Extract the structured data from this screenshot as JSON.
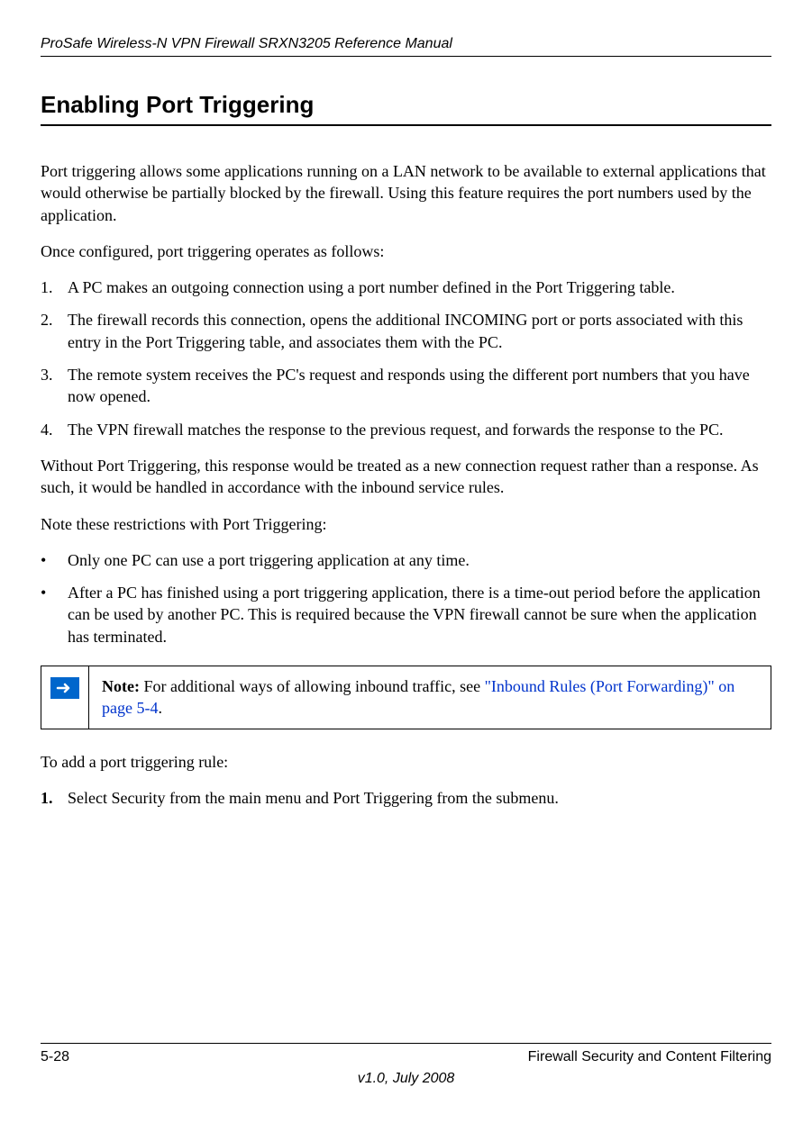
{
  "header": {
    "title": "ProSafe Wireless-N VPN Firewall SRXN3205 Reference Manual"
  },
  "section": {
    "heading": "Enabling Port Triggering"
  },
  "paragraphs": {
    "p1": "Port triggering allows some applications running on a LAN network to be available to external applications that would otherwise be partially blocked by the firewall. Using this feature requires the port numbers used by the application.",
    "p2": "Once configured, port triggering operates as follows:",
    "p3": "Without Port Triggering, this response would be treated as a new connection request rather than a response. As such, it would be handled in accordance with the inbound service rules.",
    "p4": "Note these restrictions with Port Triggering:",
    "p5": "To add a port triggering rule:"
  },
  "ordered_list": [
    {
      "num": "1.",
      "text": "A PC makes an outgoing connection using a port number defined in the Port Triggering table."
    },
    {
      "num": "2.",
      "text": "The firewall records this connection, opens the additional INCOMING port or ports associated with this entry in the Port Triggering table, and associates them with the PC."
    },
    {
      "num": "3.",
      "text": "The remote system receives the PC's request and responds using the different port numbers that you have now opened."
    },
    {
      "num": "4.",
      "text": "The VPN firewall matches the response to the previous request, and forwards the response to the PC."
    }
  ],
  "bullet_list": [
    {
      "marker": "•",
      "text": "Only one PC can use a port triggering application at any time."
    },
    {
      "marker": "•",
      "text": "After a PC has finished using a port triggering application, there is a time-out period before the application can be used by another PC. This is required because the VPN firewall cannot be sure when the application has terminated."
    }
  ],
  "note": {
    "label": "Note:",
    "text_before_link": " For additional ways of allowing inbound traffic, see ",
    "link_text": "\"Inbound Rules (Port Forwarding)\" on page 5-4",
    "text_after_link": "."
  },
  "steps": [
    {
      "num": "1.",
      "text": "Select Security from the main menu and Port Triggering from the submenu."
    }
  ],
  "footer": {
    "page_number": "5-28",
    "section_name": "Firewall Security and Content Filtering",
    "version": "v1.0, July 2008"
  }
}
